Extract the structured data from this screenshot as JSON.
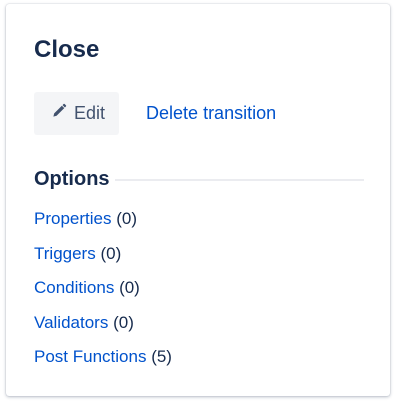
{
  "transition": {
    "title": "Close"
  },
  "actions": {
    "edit_label": "Edit",
    "edit_icon": "pencil-icon",
    "delete_label": "Delete transition"
  },
  "options": {
    "heading": "Options",
    "items": [
      {
        "label": "Properties",
        "count": "(0)"
      },
      {
        "label": "Triggers",
        "count": "(0)"
      },
      {
        "label": "Conditions",
        "count": "(0)"
      },
      {
        "label": "Validators",
        "count": "(0)"
      },
      {
        "label": "Post Functions",
        "count": "(5)"
      }
    ]
  },
  "colors": {
    "link": "#0052cc",
    "heading": "#172b4d",
    "button_bg": "#f4f5f7",
    "button_text": "#42526e"
  }
}
